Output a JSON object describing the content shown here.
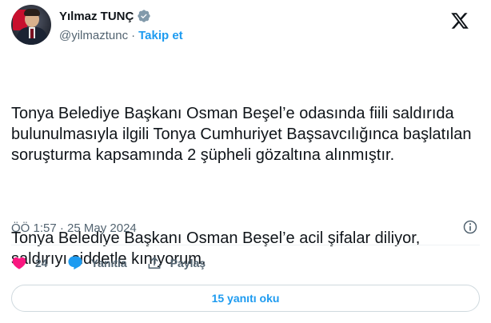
{
  "author": {
    "display_name": "Yılmaz TUNÇ",
    "handle": "@yilmaztunc",
    "separator": "·",
    "follow_label": "Takip et",
    "verified": true,
    "verified_color": "#829aab"
  },
  "tweet": {
    "paragraphs": [
      "Tonya Belediye Başkanı Osman Beşel’e odasında fiili saldırıda bulunulmasıyla ilgili Tonya Cumhuriyet Başsavcılığınca başlatılan soruşturma kapsamında 2 şüpheli gözaltına alınmıştır.",
      "Tonya Belediye Başkanı Osman Beşel’e acil şifalar diliyor, saldırıyı şiddetle kınıyorum."
    ],
    "timestamp": "ÖÖ 1:57 · 25 May 2024"
  },
  "actions": {
    "like_count": "24",
    "reply_label": "Yanıtla",
    "share_label": "Paylaş"
  },
  "replies_button_label": "15 yanıtı oku",
  "icons": {
    "verified": "verified-badge-icon",
    "platform": "x-logo-icon",
    "info": "info-icon",
    "like": "heart-icon",
    "reply": "speech-bubble-icon",
    "share": "share-upload-icon"
  },
  "colors": {
    "link": "#1d9bf0",
    "like": "#f91880",
    "secondary_text": "#536471",
    "primary_text": "#0f1419"
  }
}
